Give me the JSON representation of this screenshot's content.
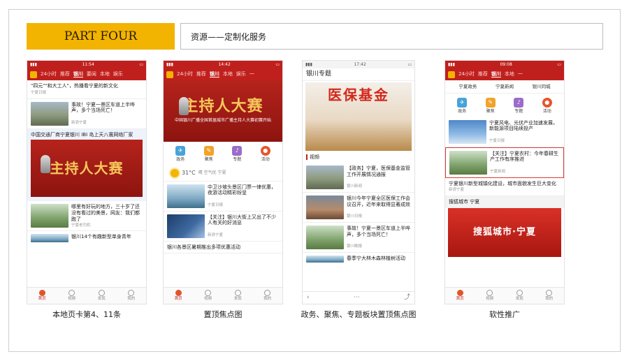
{
  "header": {
    "part_label": "PART FOUR",
    "title": "资源——定制化服务"
  },
  "captions": [
    "本地页卡第4、11条",
    "置顶焦点图",
    "政务、聚焦、专题板块置顶焦点图",
    "软性推广"
  ],
  "phone1": {
    "time": "11:54",
    "tabs": [
      "24小时",
      "推荐",
      "银川",
      "要闻",
      "本地",
      "娱乐"
    ],
    "active_tab": 2,
    "items": [
      {
        "title": "\"四元\"\"和大工人\"，热播看宁夏的新文化",
        "meta": "宁夏日报"
      },
      {
        "title": "事故！宁夏一景区车道上半哗声，多个当场死亡！",
        "meta": "新浪宁夏"
      },
      {
        "title": "中国交通厂商宁夏银川 IBI 岛上天八寰网络厂家",
        "meta": ""
      }
    ],
    "banner_text": "主持人大赛",
    "lower_items": [
      {
        "title": "哪里有好玩的地方，三十岁了还没有看过的美景，网友：我们都跑了",
        "meta": "宁夏老司机"
      },
      {
        "title": "银川14个有趣新型单身青年",
        "meta": ""
      }
    ],
    "nav": [
      "首页",
      "视频",
      "发现",
      "我的"
    ]
  },
  "phone2": {
    "time": "14:42",
    "tabs": [
      "24小时",
      "推荐",
      "银川",
      "本地",
      "娱乐",
      "一"
    ],
    "active_tab": 2,
    "banner_text": "主持人大赛",
    "banner_sub": "中国银川广播全国首届城市广播主持人大赛初赛开始",
    "icons": [
      "政务",
      "聚焦",
      "专题",
      "活动"
    ],
    "weather": "31°C",
    "weather_note": "晴 空气优 宁夏",
    "items": [
      {
        "title": "中卫沙坡头景区门票一律优惠，夜游活动精彩纷呈",
        "meta": "宁夏日报"
      },
      {
        "title": "【关注】银川大街上又出了不少人有关的好消息",
        "meta": "新浪宁夏"
      },
      {
        "title": "银川各景区暑期推出多项优惠活动",
        "meta": ""
      }
    ],
    "nav": [
      "首页",
      "视频",
      "发现",
      "我的"
    ]
  },
  "phone3": {
    "time": "17:42",
    "head_title": "银川专题",
    "hero_text": "医保基金",
    "section": "视频",
    "items": [
      {
        "title": "【政务】宁夏，医保基金监管工作开展情况通报",
        "meta": "银川新闻"
      },
      {
        "title": "银川今年宁夏全区医保工作会议召开，近年来取得显著成效",
        "meta": "银川日报"
      },
      {
        "title": "事故！宁夏一景区车道上半哗声，多个当场死亡！",
        "meta": "银川晚报"
      },
      {
        "title": "春季宁大林木森林植树活动",
        "meta": ""
      }
    ]
  },
  "phone4": {
    "time": "09:08",
    "tabs": [
      "24小时",
      "推荐",
      "银川",
      "本地",
      "一"
    ],
    "active_tab": 2,
    "subnav": [
      "宁夏政务",
      "宁夏新闻",
      "银川同城"
    ],
    "icons": [
      "政务",
      "聚焦",
      "专题",
      "活动"
    ],
    "items": [
      {
        "title": "宁夏风电、光伏产业加速发展，新能源项目陆续投产",
        "meta": "宁夏日报"
      },
      {
        "title": "【关注】宁夏农村：今年春耕生产工作有序推进",
        "meta": "宁夏新闻"
      },
      {
        "title": "宁夏银川新型城镇化建设，城市面貌发生巨大变化",
        "meta": "新浪宁夏"
      }
    ],
    "soft_title": "搜狐城市 宁夏",
    "soft_banner": "搜狐城市·宁夏",
    "nav": [
      "首页",
      "视频",
      "发现",
      "我的"
    ]
  }
}
